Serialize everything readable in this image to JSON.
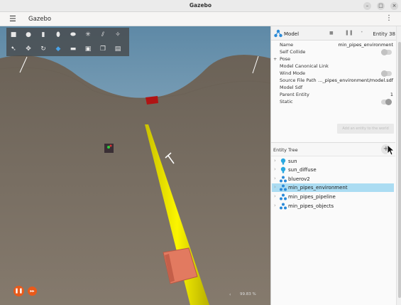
{
  "window": {
    "title": "Gazebo",
    "minimize_glyph": "–",
    "maximize_glyph": "□",
    "close_glyph": "×"
  },
  "app": {
    "title": "Gazebo",
    "menu_icon": "hamburger-icon",
    "more_icon": "kebab-icon"
  },
  "toolbar": {
    "row1": [
      "box-icon",
      "sphere-icon",
      "cylinder-icon",
      "capsule-icon",
      "ellipsoid-icon",
      "sun-light-icon",
      "directional-light-icon",
      "spot-light-icon"
    ],
    "row2": [
      "select-icon",
      "translate-icon",
      "rotate-icon",
      "snap-icon",
      "screenshot-icon",
      "camera-icon",
      "copy-icon",
      "paste-icon"
    ]
  },
  "playback": {
    "play_icon": "pause-icon",
    "step_icon": "step-icon",
    "rtf": "99.83 %"
  },
  "component_inspector": {
    "title": "Model",
    "entity_label": "Entity 38",
    "properties": [
      {
        "key": "Name",
        "value": "min_pipes_environment"
      },
      {
        "key": "Self Collide",
        "toggle": false
      },
      {
        "key": "Pose",
        "expandable": true
      },
      {
        "key": "Model Canonical Link",
        "value": ""
      },
      {
        "key": "Wind Mode",
        "toggle": false
      },
      {
        "key": "Source File Path",
        "value": "..._pipes_environment/model.sdf"
      },
      {
        "key": "Model Sdf",
        "value": ""
      },
      {
        "key": "Parent Entity",
        "value": "1"
      },
      {
        "key": "Static",
        "toggle": true
      }
    ],
    "add_entity_label": "Add an entity to the world"
  },
  "entity_tree": {
    "title": "Entity Tree",
    "add_glyph": "+",
    "items": [
      {
        "label": "sun",
        "icon": "light-bulb-icon",
        "selected": false
      },
      {
        "label": "sun_diffuse",
        "icon": "light-bulb-icon",
        "selected": false
      },
      {
        "label": "bluerov2",
        "icon": "model-icon",
        "selected": false
      },
      {
        "label": "min_pipes_environment",
        "icon": "model-icon",
        "selected": true
      },
      {
        "label": "min_pipes_pipeline",
        "icon": "model-icon",
        "selected": false
      },
      {
        "label": "min_pipes_objects",
        "icon": "model-icon",
        "selected": false
      }
    ]
  },
  "colors": {
    "accent_orange": "#e85a1b",
    "selection_blue": "#abdcf2",
    "pipe_yellow": "#f7f000",
    "ground": "#7a6f63"
  }
}
